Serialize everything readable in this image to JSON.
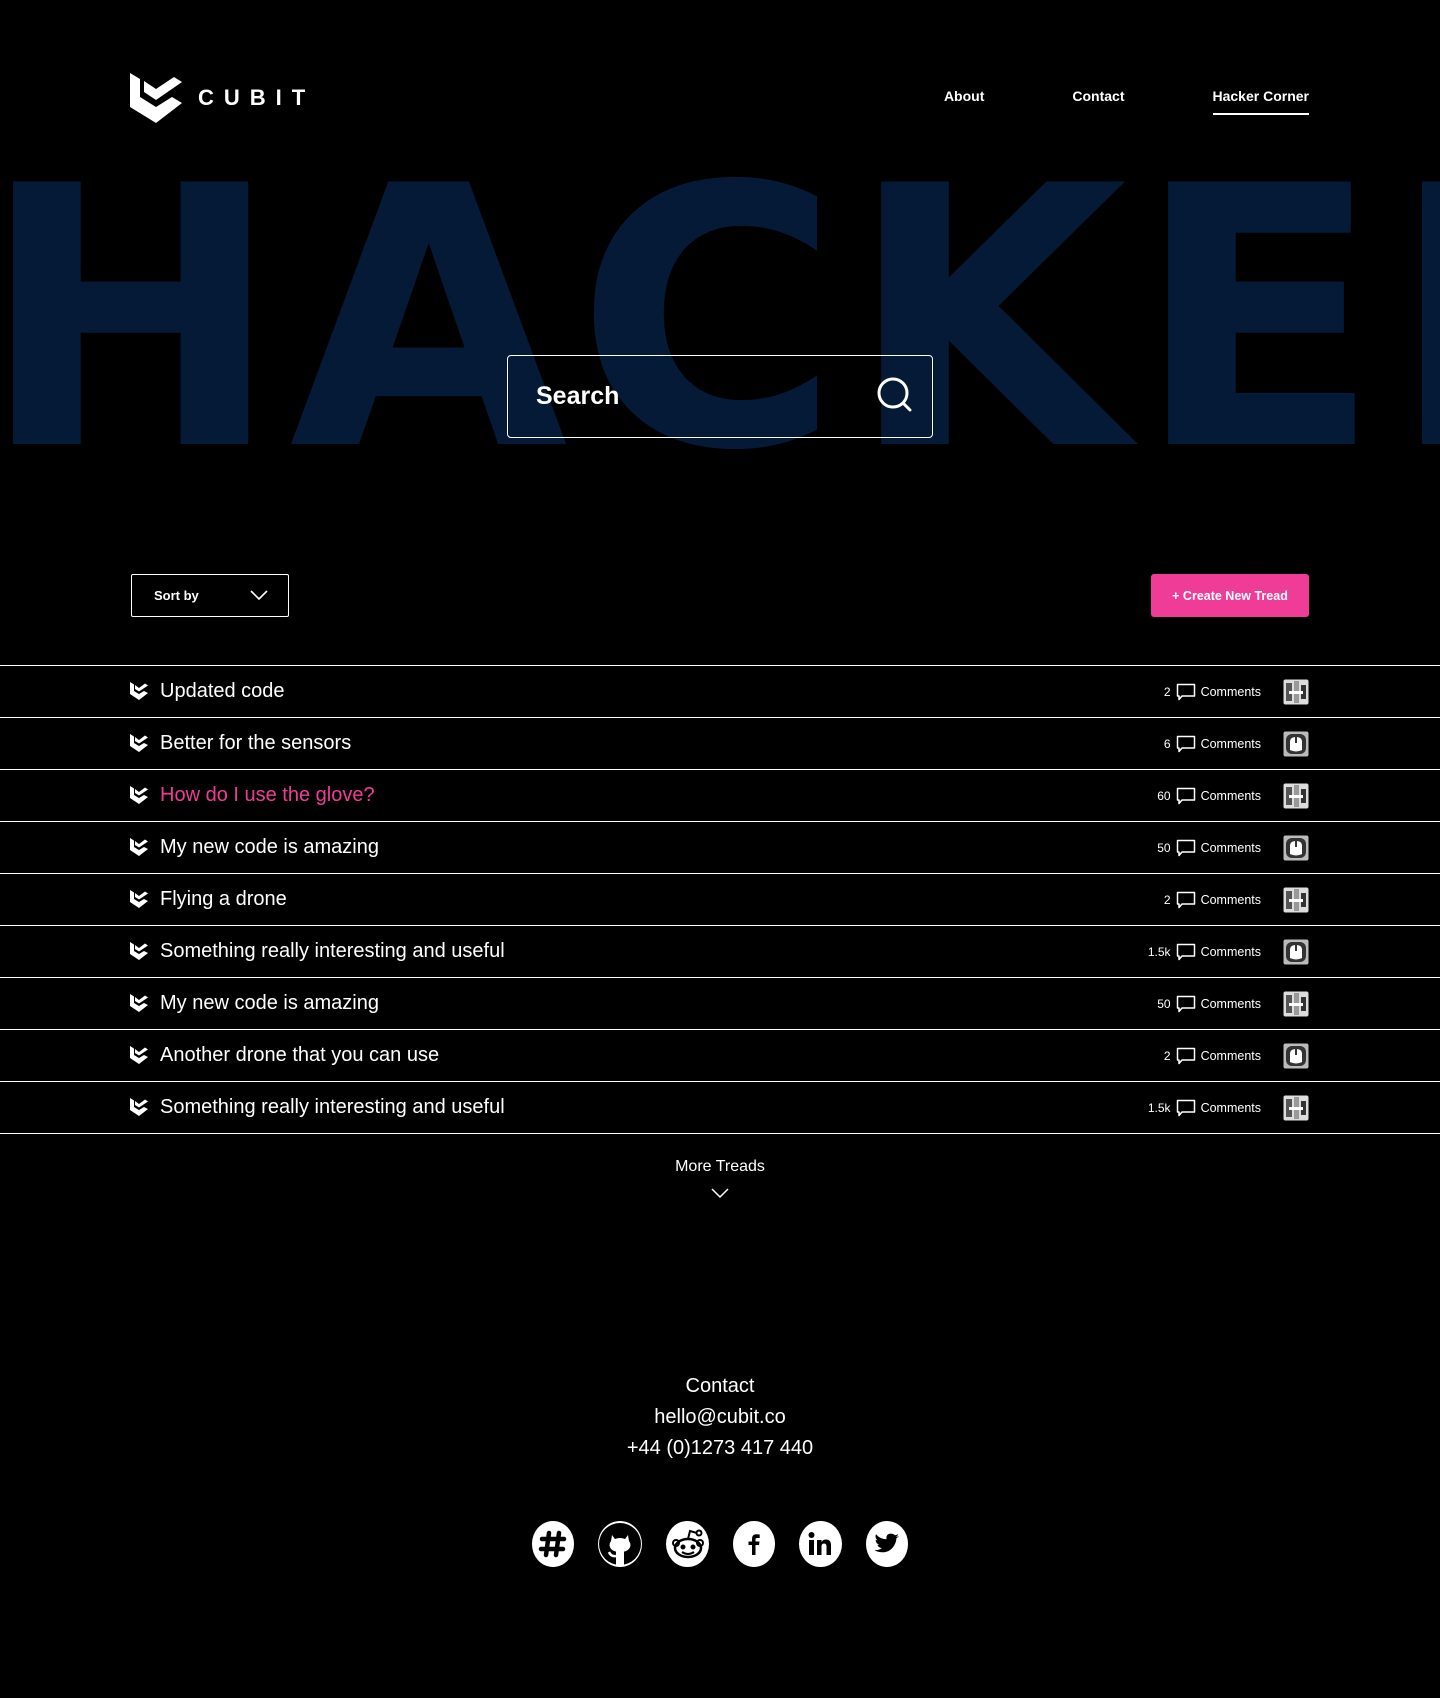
{
  "brand": {
    "name": "CUBIT"
  },
  "nav": {
    "items": [
      {
        "label": "About"
      },
      {
        "label": "Contact"
      },
      {
        "label": "Hacker Corner",
        "active": true
      }
    ]
  },
  "hero": {
    "word": "HACKER"
  },
  "search": {
    "placeholder": "Search",
    "value": ""
  },
  "toolbar": {
    "sort_label": "Sort by",
    "create_label": "+ Create New Tread"
  },
  "threads": [
    {
      "title": "Updated code",
      "count": "2",
      "comments_label": "Comments"
    },
    {
      "title": "Better for the sensors",
      "count": "6",
      "comments_label": "Comments"
    },
    {
      "title": "How do I use the glove?",
      "count": "60",
      "comments_label": "Comments",
      "highlighted": true
    },
    {
      "title": "My new code is amazing",
      "count": "50",
      "comments_label": "Comments"
    },
    {
      "title": "Flying a drone",
      "count": "2",
      "comments_label": "Comments"
    },
    {
      "title": "Something really interesting and useful",
      "count": "1.5k",
      "comments_label": "Comments"
    },
    {
      "title": "My new code is amazing",
      "count": "50",
      "comments_label": "Comments"
    },
    {
      "title": "Another drone that you can use",
      "count": "2",
      "comments_label": "Comments"
    },
    {
      "title": "Something really interesting and useful",
      "count": "1.5k",
      "comments_label": "Comments"
    }
  ],
  "more": {
    "label": "More Treads"
  },
  "footer": {
    "heading": "Contact",
    "email": "hello@cubit.co",
    "phone": "+44 (0)1273 417 440",
    "socials": [
      "slack-icon",
      "github-icon",
      "reddit-icon",
      "facebook-icon",
      "linkedin-icon",
      "twitter-icon"
    ]
  },
  "colors": {
    "background": "#000000",
    "accent": "#ef3d97",
    "hero_text": "#051a36",
    "text": "#ffffff"
  }
}
